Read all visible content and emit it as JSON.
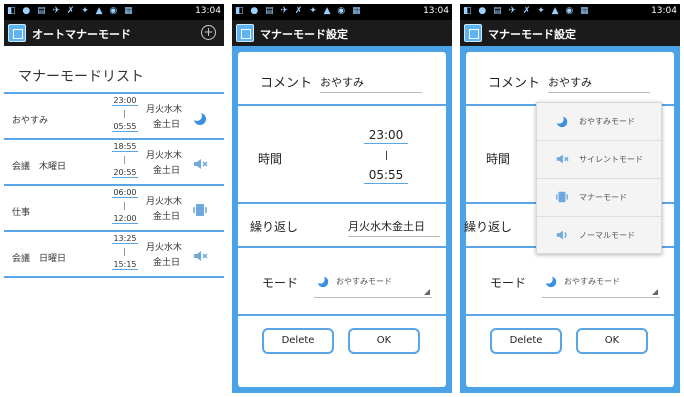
{
  "status": {
    "time": "13:04",
    "icons": "◧ ● ▤ ✈ ✗ ✦ ▲ ◉ ▦",
    "signal": "▲▌ ▭"
  },
  "screen1": {
    "title": "オートマナーモード",
    "add_icon": "plus-circle-icon",
    "list_header": "マナーモードリスト",
    "rows": [
      {
        "name": "おやすみ",
        "start": "23:00",
        "end": "05:55",
        "days_line1": "月火水木",
        "days_line2": "金土日",
        "mode_icon": "moon-icon"
      },
      {
        "name": "会議　木曜日",
        "start": "18:55",
        "end": "20:55",
        "days_line1": "月火水木",
        "days_line2": "金土日",
        "mode_icon": "speaker-mute-icon"
      },
      {
        "name": "仕事",
        "start": "06:00",
        "end": "12:00",
        "days_line1": "月火水木",
        "days_line2": "金土日",
        "mode_icon": "vibrate-icon"
      },
      {
        "name": "会議　日曜日",
        "start": "13:25",
        "end": "15:15",
        "days_line1": "月火水木",
        "days_line2": "金土日",
        "mode_icon": "speaker-mute-icon"
      }
    ]
  },
  "screen2": {
    "title": "マナーモード設定",
    "comment_label": "コメント",
    "comment_value": "おやすみ",
    "time_label": "時間",
    "start_time": "23:00",
    "end_time": "05:55",
    "repeat_label": "繰り返し",
    "repeat_value": "月火水木金土日",
    "mode_label": "モード",
    "mode_value": "おやすみモード",
    "delete_label": "Delete",
    "ok_label": "OK"
  },
  "screen3": {
    "title": "マナーモード設定",
    "comment_label": "コメント",
    "comment_value": "おやすみ",
    "time_label": "時間",
    "repeat_label": "繰り返し",
    "mode_label": "モード",
    "mode_value": "おやすみモード",
    "delete_label": "Delete",
    "ok_label": "OK",
    "options": [
      {
        "label": "おやすみモード",
        "icon": "moon-icon"
      },
      {
        "label": "サイレントモード",
        "icon": "speaker-mute-icon"
      },
      {
        "label": "マナーモード",
        "icon": "vibrate-icon"
      },
      {
        "label": "ノーマルモード",
        "icon": "speaker-icon"
      }
    ]
  },
  "colors": {
    "accent": "#5aa5e5",
    "frame": "#4aa3e6",
    "titlebar": "#1b1b1b"
  }
}
